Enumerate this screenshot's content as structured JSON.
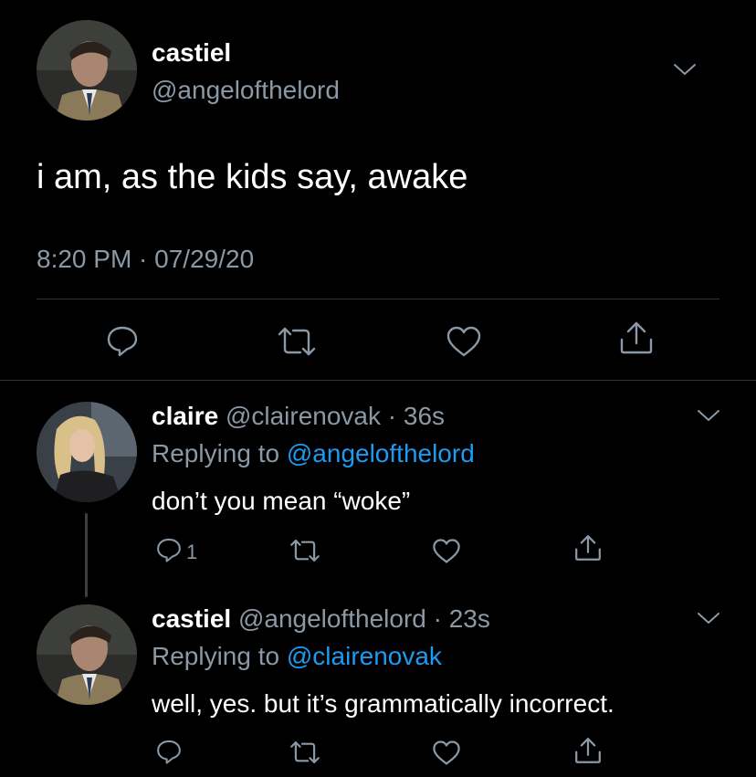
{
  "main_tweet": {
    "display_name": "castiel",
    "handle": "@angelofthelord",
    "text": "i am, as the kids say, awake",
    "timestamp": "8:20 PM · 07/29/20",
    "actions": [
      "reply-icon",
      "retweet-icon",
      "like-icon",
      "share-icon"
    ]
  },
  "replies": [
    {
      "display_name": "claire",
      "handle_time": "@clairenovak · 36s",
      "replying_prefix": "Replying to",
      "replying_to": "@angelofthelord",
      "text": "don’t you mean “woke”",
      "reply_count": "1"
    },
    {
      "display_name": "castiel",
      "handle_time": "@angelofthelord · 23s",
      "replying_prefix": "Replying to",
      "replying_to": "@clairenovak",
      "text": "well, yes. but it’s grammatically incorrect.",
      "reply_count": ""
    }
  ],
  "colors": {
    "background": "#000000",
    "muted": "#8b98a5",
    "link": "#1d9bf0",
    "divider": "#2f3336"
  }
}
